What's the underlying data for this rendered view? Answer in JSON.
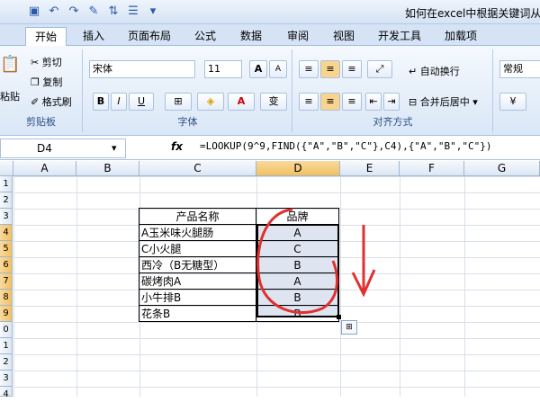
{
  "window": {
    "title": "如何在excel中根据关键词从字"
  },
  "quick_access": {
    "icons": [
      "save-icon",
      "undo-icon",
      "redo-icon",
      "format-painter-icon",
      "sort-icon",
      "filter-icon",
      "customize-icon"
    ]
  },
  "tabs": [
    "开始",
    "插入",
    "页面布局",
    "公式",
    "数据",
    "审阅",
    "视图",
    "开发工具",
    "加载项"
  ],
  "ribbon": {
    "clipboard": {
      "paste": "粘贴",
      "cut": "剪切",
      "copy": "复制",
      "format_painter": "格式刷",
      "label": "剪贴板"
    },
    "font": {
      "name": "宋体",
      "size": "11",
      "grow": "A",
      "shrink": "A",
      "bold": "B",
      "italic": "I",
      "underline": "U",
      "phonetic": "变",
      "label": "字体"
    },
    "alignment": {
      "wrap": "自动换行",
      "merge": "合并后居中",
      "label": "对齐方式"
    },
    "number": {
      "format": "常规"
    }
  },
  "formula_bar": {
    "name_box": "D4",
    "fx": "fx",
    "formula": "=LOOKUP(9^9,FIND({\"A\",\"B\",\"C\"},C4),{\"A\",\"B\",\"C\"})"
  },
  "columns": [
    "A",
    "B",
    "C",
    "D",
    "E",
    "F",
    "G"
  ],
  "rows": [
    "1",
    "2",
    "3",
    "4",
    "5",
    "6",
    "7",
    "8",
    "9",
    "0",
    "1",
    "2",
    "3",
    "4"
  ],
  "table": {
    "header": {
      "name": "产品名称",
      "brand": "品牌"
    },
    "rows": [
      {
        "name": "A玉米味火腿肠",
        "brand": "A"
      },
      {
        "name": "C小火腿",
        "brand": "C"
      },
      {
        "name": "西冷（B无糖型）",
        "brand": "B"
      },
      {
        "name": "碳烤肉A",
        "brand": "A"
      },
      {
        "name": "小牛排B",
        "brand": "B"
      },
      {
        "name": "花条B",
        "brand": "B"
      }
    ]
  },
  "annotation_color": "#e03030"
}
